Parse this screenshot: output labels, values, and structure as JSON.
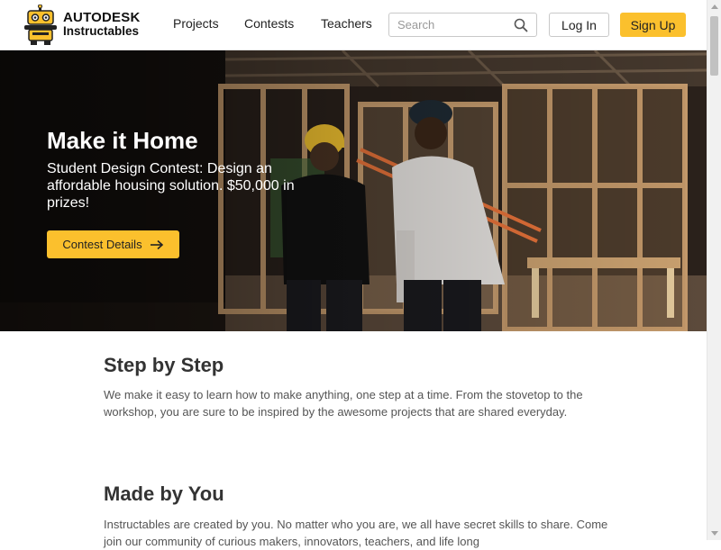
{
  "header": {
    "logo_line1": "AUTODESK",
    "logo_line2": "Instructables",
    "nav": [
      "Projects",
      "Contests",
      "Teachers"
    ],
    "search_placeholder": "Search",
    "login_label": "Log In",
    "signup_label": "Sign Up"
  },
  "hero": {
    "title": "Make it Home",
    "subtitle": "Student Design Contest: Design an affordable housing solution. $50,000 in prizes!",
    "button_label": "Contest Details"
  },
  "sections": [
    {
      "title": "Step by Step",
      "text": "We make it easy to learn how to make anything, one step at a time. From the stovetop to the workshop, you are sure to be inspired by the awesome projects that are shared everyday."
    },
    {
      "title": "Made by You",
      "text": "Instructables are created by you. No matter who you are, we all have secret skills to share. Come join our community of curious makers, innovators, teachers, and life long"
    }
  ],
  "colors": {
    "accent": "#fbc02d",
    "text": "#333333"
  },
  "icons": {
    "logo": "robot-mascot-icon",
    "search": "search-icon",
    "button_arrow": "arrow-right-icon"
  }
}
